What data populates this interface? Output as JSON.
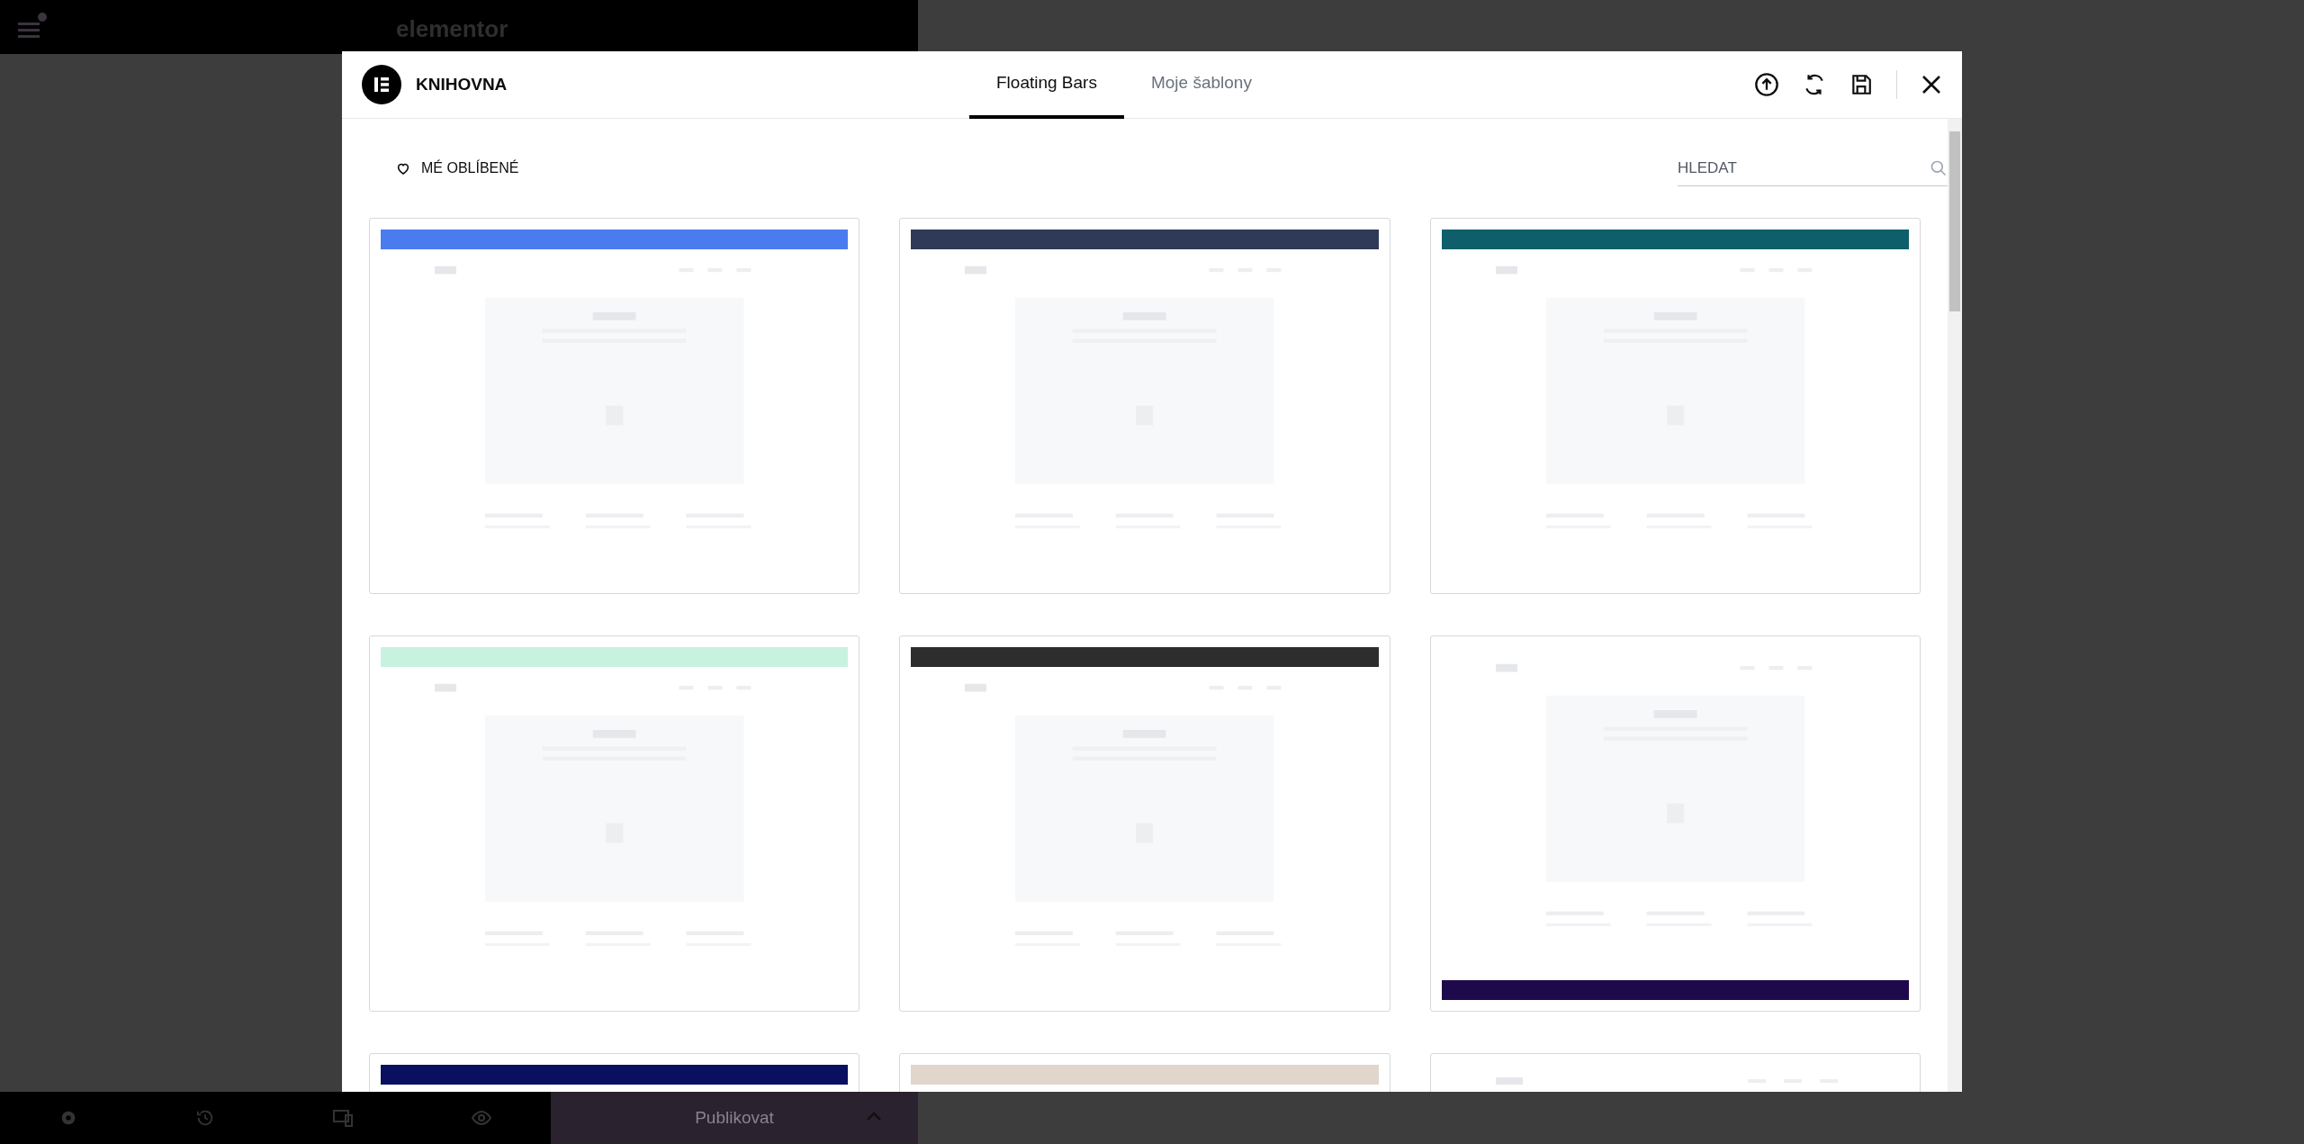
{
  "top_bar": {
    "logo": "elementor"
  },
  "library": {
    "title": "KNIHOVNA",
    "tabs": [
      {
        "label": "Floating Bars",
        "selected": true
      },
      {
        "label": "Moje šablony",
        "selected": false
      }
    ],
    "favorites": "MÉ OBLÍBENÉ",
    "search": {
      "placeholder": "HLEDAT"
    },
    "templates": [
      {
        "kind": "top",
        "color": "#4a7cf0"
      },
      {
        "kind": "top",
        "color": "#2f3a58"
      },
      {
        "kind": "top",
        "color": "#0e5f6b"
      },
      {
        "kind": "top",
        "color": "#c8f2e0"
      },
      {
        "kind": "top",
        "color": "#2d2d2d"
      },
      {
        "kind": "bottom",
        "color": "#1e0a4a"
      },
      {
        "kind": "top",
        "color": "#0a1060"
      },
      {
        "kind": "top",
        "color": "#e0d6cc"
      },
      {
        "kind": "none"
      }
    ]
  },
  "bottom_bar": {
    "publish": "Publikovat"
  }
}
